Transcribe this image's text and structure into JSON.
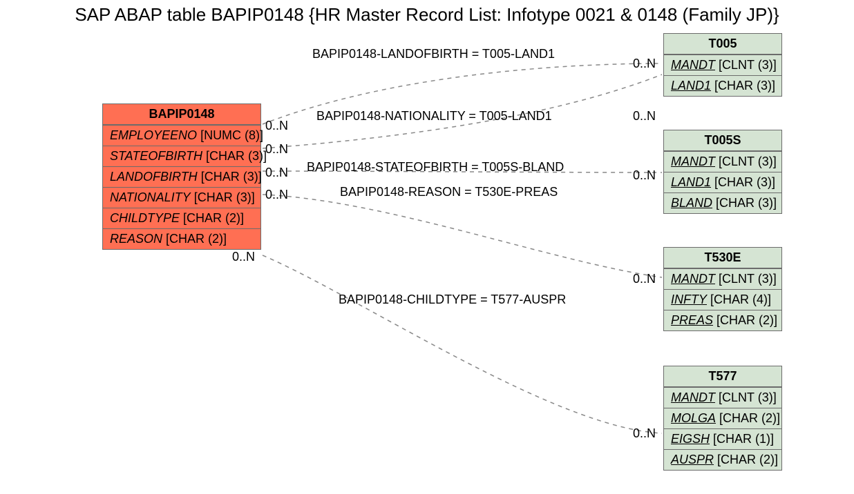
{
  "title": "SAP ABAP table BAPIP0148 {HR Master Record List: Infotype 0021 & 0148 (Family JP)}",
  "main_table": {
    "name": "BAPIP0148",
    "fields": [
      {
        "name": "EMPLOYEENO",
        "type": "[NUMC (8)]",
        "italic": false,
        "underline": false
      },
      {
        "name": "STATEOFBIRTH",
        "type": "[CHAR (3)]",
        "italic": true,
        "underline": false
      },
      {
        "name": "LANDOFBIRTH",
        "type": "[CHAR (3)]",
        "italic": true,
        "underline": false
      },
      {
        "name": "NATIONALITY",
        "type": "[CHAR (3)]",
        "italic": true,
        "underline": false
      },
      {
        "name": "CHILDTYPE",
        "type": "[CHAR (2)]",
        "italic": true,
        "underline": false
      },
      {
        "name": "REASON",
        "type": "[CHAR (2)]",
        "italic": true,
        "underline": false
      }
    ]
  },
  "ref_tables": [
    {
      "name": "T005",
      "fields": [
        {
          "name": "MANDT",
          "type": "[CLNT (3)]",
          "italic": true,
          "underline": true
        },
        {
          "name": "LAND1",
          "type": "[CHAR (3)]",
          "italic": false,
          "underline": true
        }
      ]
    },
    {
      "name": "T005S",
      "fields": [
        {
          "name": "MANDT",
          "type": "[CLNT (3)]",
          "italic": true,
          "underline": true
        },
        {
          "name": "LAND1",
          "type": "[CHAR (3)]",
          "italic": true,
          "underline": true
        },
        {
          "name": "BLAND",
          "type": "[CHAR (3)]",
          "italic": false,
          "underline": true
        }
      ]
    },
    {
      "name": "T530E",
      "fields": [
        {
          "name": "MANDT",
          "type": "[CLNT (3)]",
          "italic": true,
          "underline": true
        },
        {
          "name": "INFTY",
          "type": "[CHAR (4)]",
          "italic": true,
          "underline": true
        },
        {
          "name": "PREAS",
          "type": "[CHAR (2)]",
          "italic": false,
          "underline": true
        }
      ]
    },
    {
      "name": "T577",
      "fields": [
        {
          "name": "MANDT",
          "type": "[CLNT (3)]",
          "italic": true,
          "underline": true
        },
        {
          "name": "MOLGA",
          "type": "[CHAR (2)]",
          "italic": true,
          "underline": true
        },
        {
          "name": "EIGSH",
          "type": "[CHAR (1)]",
          "italic": true,
          "underline": true
        },
        {
          "name": "AUSPR",
          "type": "[CHAR (2)]",
          "italic": false,
          "underline": true
        }
      ]
    }
  ],
  "relations": [
    {
      "label": "BAPIP0148-LANDOFBIRTH = T005-LAND1"
    },
    {
      "label": "BAPIP0148-NATIONALITY = T005-LAND1"
    },
    {
      "label": "BAPIP0148-STATEOFBIRTH = T005S-BLAND"
    },
    {
      "label": "BAPIP0148-REASON = T530E-PREAS"
    },
    {
      "label": "BAPIP0148-CHILDTYPE = T577-AUSPR"
    }
  ],
  "cardinality": "0..N",
  "left_cards": [
    "0..N",
    "0..N",
    "0..N",
    "0..N",
    "0..N"
  ],
  "right_cards": [
    "0..N",
    "0..N",
    "0..N",
    "0..N",
    "0..N"
  ]
}
